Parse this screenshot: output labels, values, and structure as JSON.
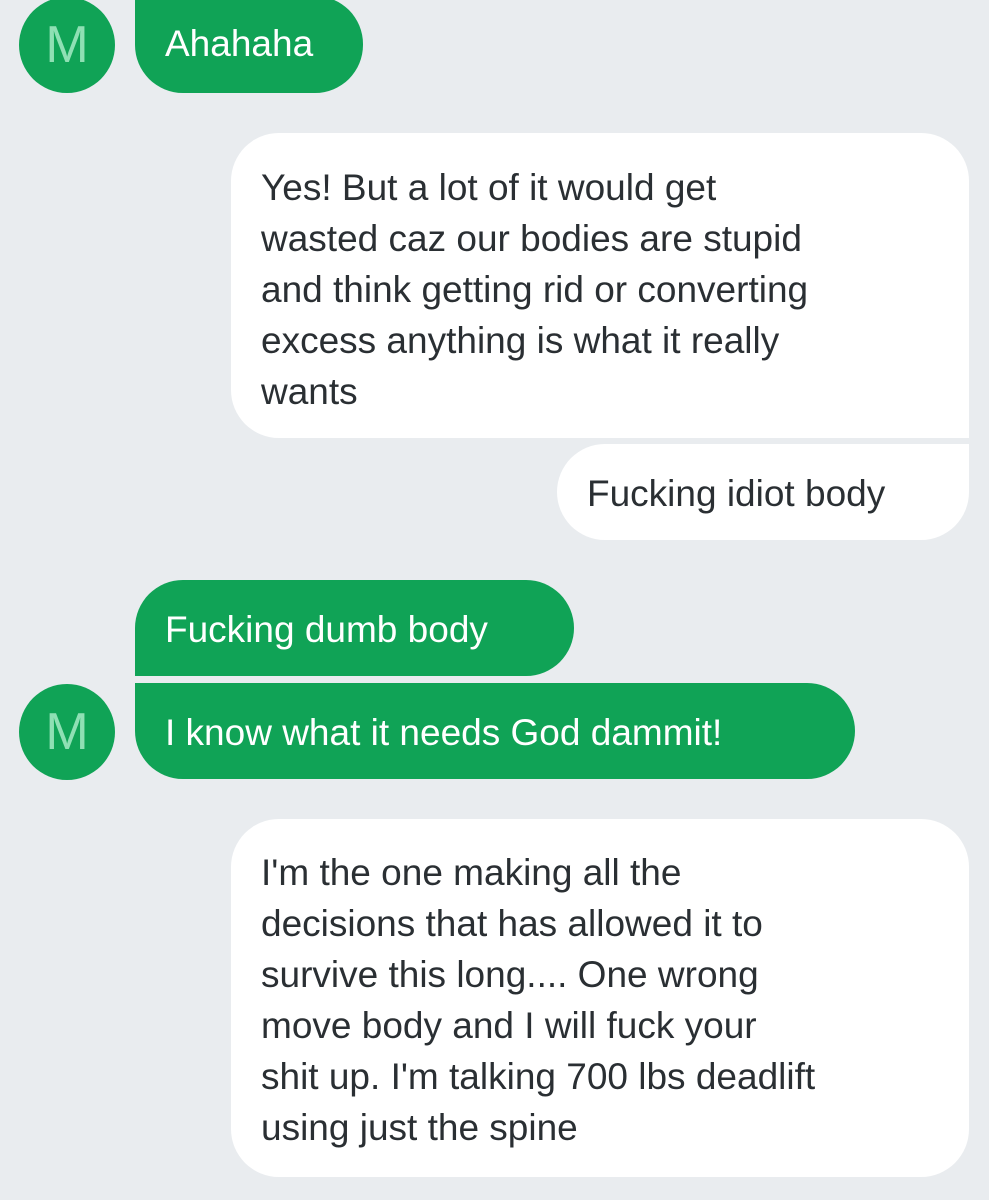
{
  "conversation": {
    "contact_initial": "M",
    "messages": [
      {
        "direction": "incoming",
        "text": "Ahahaha"
      },
      {
        "direction": "outgoing",
        "text": "Yes! But a lot of it would get\nwasted caz our bodies are stupid\nand think getting rid or converting\nexcess anything is what it really\nwants"
      },
      {
        "direction": "outgoing",
        "text": "Fucking idiot body"
      },
      {
        "direction": "incoming",
        "text": "Fucking dumb body"
      },
      {
        "direction": "incoming",
        "text": "I know what it needs God dammit!"
      },
      {
        "direction": "outgoing",
        "text": "I'm the one making all the\ndecisions that has allowed it to\nsurvive this long.... One wrong\nmove body and I will fuck your\nshit up. I'm talking 700 lbs deadlift\nusing just the spine"
      }
    ]
  },
  "colors": {
    "background": "#e9ecef",
    "incoming_bubble": "#10a356",
    "outgoing_bubble": "#ffffff",
    "avatar_letter": "#8fe0b4"
  }
}
